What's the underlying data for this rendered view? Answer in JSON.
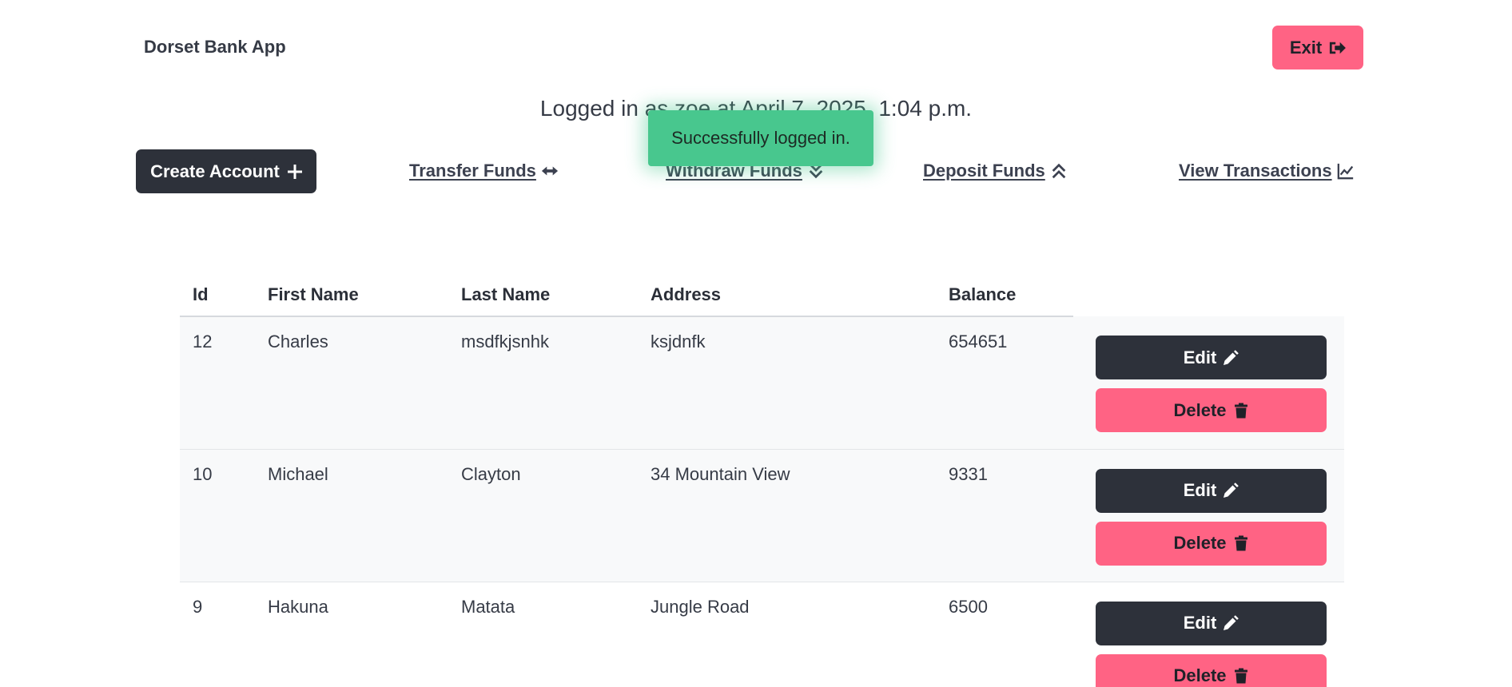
{
  "app": {
    "title": "Dorset Bank App",
    "exit_label": "Exit"
  },
  "status": {
    "login_text": "Logged in as zoe at April 7, 2025, 1:04 p.m."
  },
  "toast": {
    "message": "Successfully logged in.",
    "color": "#48c78e"
  },
  "nav": {
    "create_label": "Create Account",
    "transfer_label": "Transfer Funds",
    "withdraw_label": "Withdraw Funds",
    "deposit_label": "Deposit Funds",
    "view_label": "View Transactions"
  },
  "table": {
    "headers": [
      "Id",
      "First Name",
      "Last Name",
      "Address",
      "Balance"
    ],
    "rows": [
      {
        "id": "12",
        "first": "Charles",
        "last": "msdfkjsnhk",
        "address": "ksjdnfk",
        "balance": "654651"
      },
      {
        "id": "10",
        "first": "Michael",
        "last": "Clayton",
        "address": "34 Mountain View",
        "balance": "9331"
      },
      {
        "id": "9",
        "first": "Hakuna",
        "last": "Matata",
        "address": "Jungle Road",
        "balance": "6500"
      }
    ],
    "edit_label": "Edit",
    "delete_label": "Delete"
  },
  "icons": {
    "exit": "sign-out-icon",
    "create": "plus-icon",
    "transfer": "arrows-left-right-icon",
    "withdraw": "double-chevron-down-icon",
    "deposit": "double-chevron-up-icon",
    "view": "line-chart-icon",
    "edit": "pencil-icon",
    "delete": "trash-icon"
  },
  "colors": {
    "primary_dark": "#2d313a",
    "danger_pink": "#ff6384",
    "success_green": "#48c78e"
  }
}
